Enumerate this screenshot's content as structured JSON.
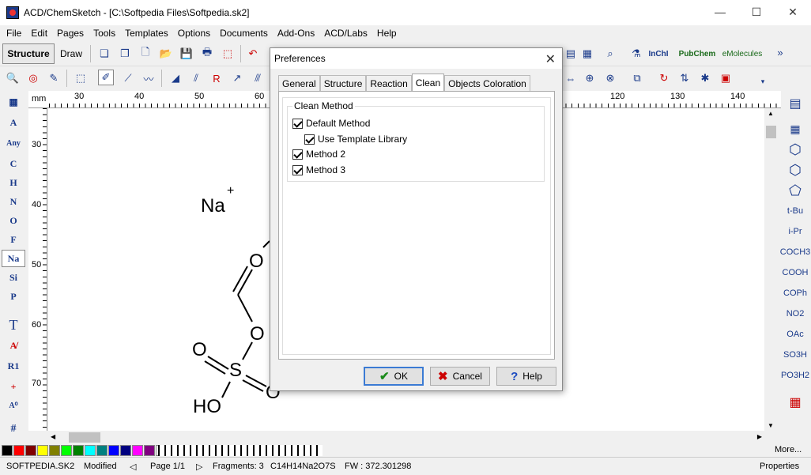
{
  "window": {
    "title": "ACD/ChemSketch - [C:\\Softpedia Files\\Softpedia.sk2]",
    "minimize": "—",
    "maximize": "☐",
    "close": "✕"
  },
  "menu": [
    "File",
    "Edit",
    "Pages",
    "Tools",
    "Templates",
    "Options",
    "Documents",
    "Add-Ons",
    "ACD/Labs",
    "Help"
  ],
  "modes": {
    "structure": "Structure",
    "draw": "Draw"
  },
  "toolbar_right": {
    "inchi": "InChI",
    "pubchem": "PubChem",
    "emolecules": "eMolecules"
  },
  "ruler": {
    "unit": "mm",
    "top_ticks": [
      "30",
      "40",
      "50",
      "60",
      "120",
      "130",
      "140"
    ],
    "left_ticks": [
      "30",
      "40",
      "50",
      "60",
      "70"
    ]
  },
  "left_palette": [
    "A",
    "Any",
    "C",
    "H",
    "N",
    "O",
    "F",
    "Na",
    "Si",
    "P",
    "T",
    "R1",
    "+",
    "#"
  ],
  "right_palette": [
    "t-Bu",
    "i-Pr",
    "COCH3",
    "COOH",
    "COPh",
    "NO2",
    "OAc",
    "SO3H",
    "PO3H2"
  ],
  "molecule": {
    "na": "Na",
    "na_charge": "+",
    "o1": "O",
    "o2": "O",
    "o3": "O",
    "s": "S",
    "o4": "O",
    "ho": "HO"
  },
  "dialog": {
    "title": "Preferences",
    "tabs": [
      "General",
      "Structure",
      "Reaction",
      "Clean",
      "Objects Coloration"
    ],
    "active_tab": "Clean",
    "group_label": "Clean Method",
    "options": [
      {
        "label": "Default Method",
        "checked": true
      },
      {
        "label": "Use Template Library",
        "checked": true
      },
      {
        "label": "Method 2",
        "checked": true
      },
      {
        "label": "Method 3",
        "checked": true
      }
    ],
    "ok": "OK",
    "cancel": "Cancel",
    "help": "Help"
  },
  "colors": [
    "#000000",
    "#ff0000",
    "#800000",
    "#ffff00",
    "#808000",
    "#00ff00",
    "#008000",
    "#00ffff",
    "#008080",
    "#0000ff",
    "#000080",
    "#ff00ff",
    "#800080",
    "#ffffff",
    "#c0c0c0",
    "#808080"
  ],
  "more_label": "More...",
  "status": {
    "file": "SOFTPEDIA.SK2",
    "modified": "Modified",
    "page": "Page 1/1",
    "fragments": "Fragments: 3",
    "formula": "C14H14Na2O7S",
    "fw": "FW : 372.301298",
    "properties": "Properties"
  }
}
